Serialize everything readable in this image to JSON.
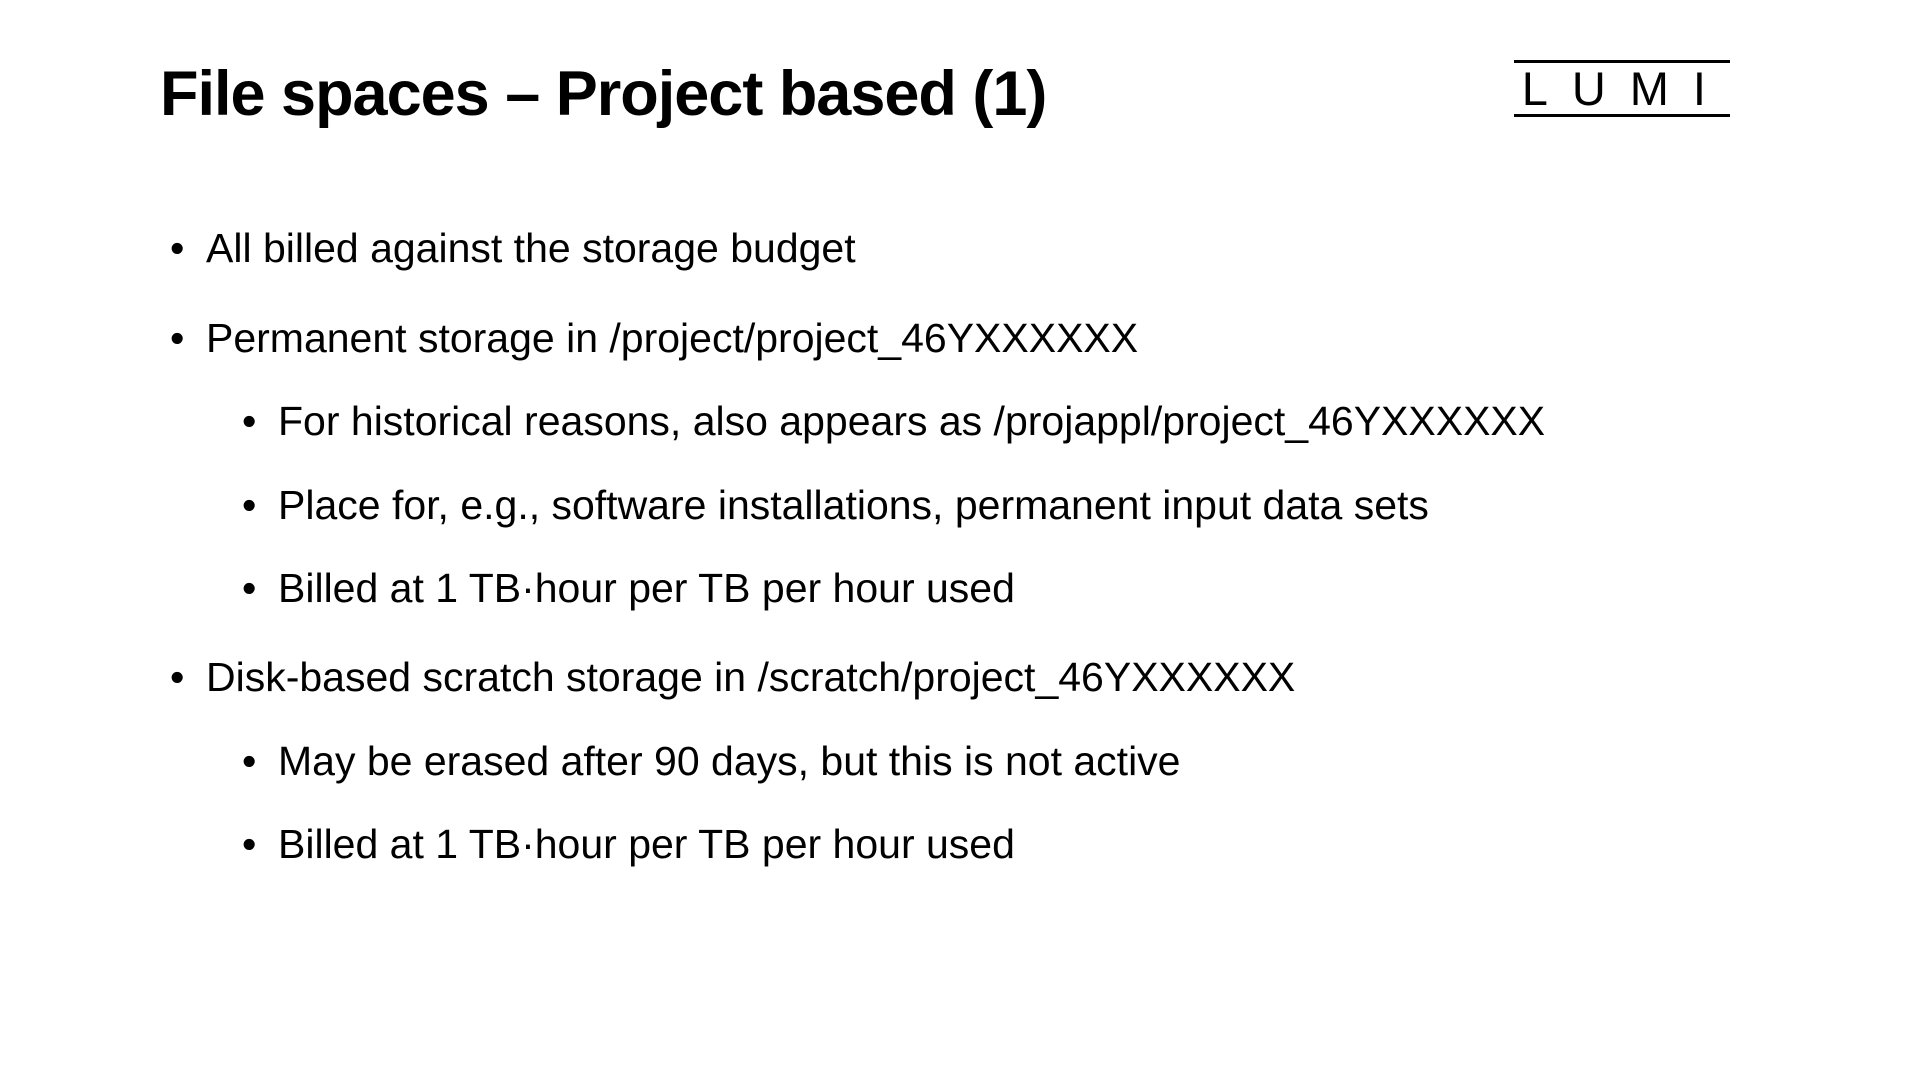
{
  "header": {
    "title": "File spaces – Project based (1)",
    "logo_text": "LUMI"
  },
  "content": {
    "bullets": [
      {
        "text": "All billed against the storage budget",
        "sub": []
      },
      {
        "text": "Permanent storage in /project/project_46YXXXXXX",
        "sub": [
          "For historical reasons, also appears as /projappl/project_46YXXXXXX",
          "Place for, e.g., software installations, permanent input data sets",
          "Billed at 1 TB·hour per TB per hour used"
        ]
      },
      {
        "text": "Disk-based scratch storage in /scratch/project_46YXXXXXX",
        "sub": [
          "May be erased after 90 days, but this is not active",
          "Billed at 1 TB·hour per TB per hour used"
        ]
      }
    ]
  }
}
